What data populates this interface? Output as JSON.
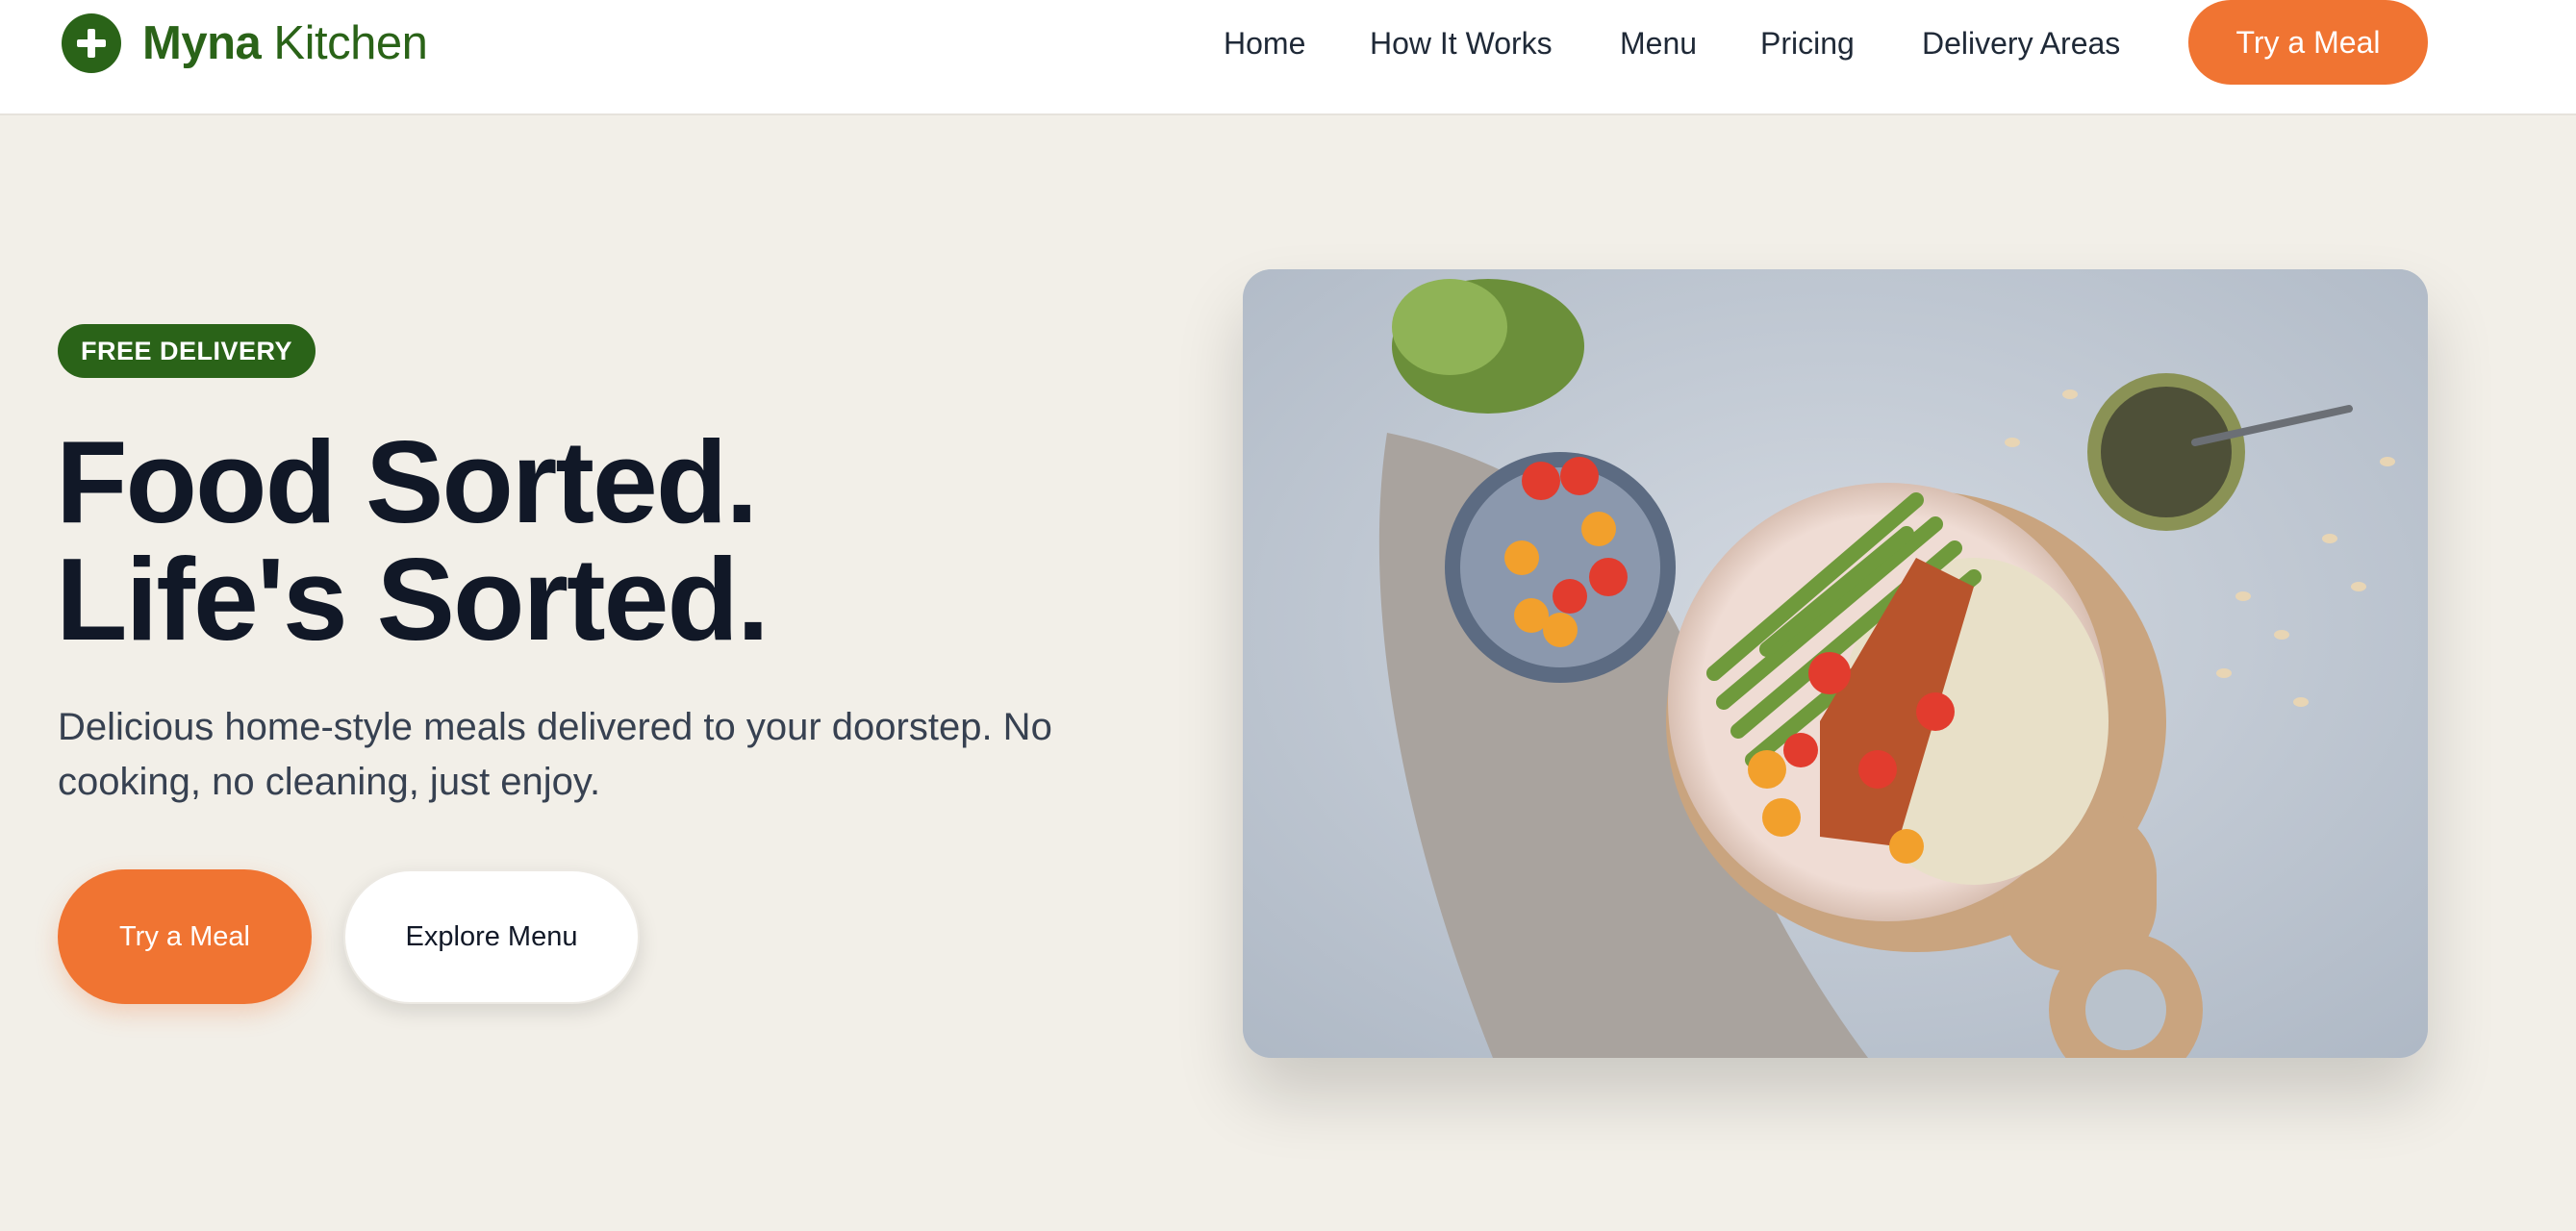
{
  "brand": {
    "name_bold": "Myna",
    "name_rest": "Kitchen",
    "icon": "plus-circle-icon",
    "color": "#2a6318"
  },
  "nav": {
    "links": [
      "Home",
      "How It Works",
      "Menu",
      "Pricing",
      "Delivery Areas"
    ],
    "cta_label": "Try a Meal"
  },
  "hero": {
    "badge": "FREE DELIVERY",
    "headline_line1": "Food Sorted.",
    "headline_line2": "Life's Sorted.",
    "subtext": "Delicious home-style meals delivered to your doorstep. No cooking, no cleaning, just enjoy.",
    "primary_button": "Try a Meal",
    "secondary_button": "Explore Menu",
    "image_subject": "plated meal of salmon, green beans, rice and cherry tomatoes on a wooden board"
  },
  "colors": {
    "accent": "#f07432",
    "brand_green": "#2a6318",
    "background": "#f2efe8",
    "heading": "#111827"
  }
}
